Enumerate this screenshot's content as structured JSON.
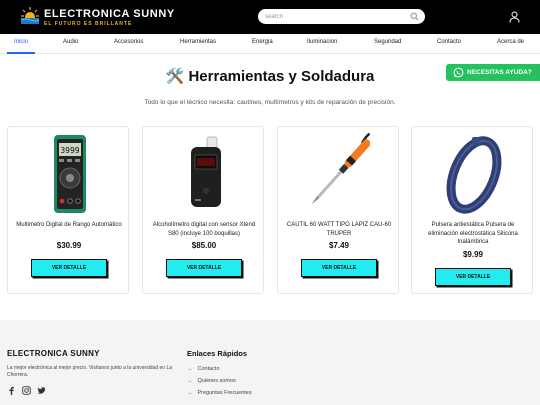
{
  "header": {
    "brand_name": "ELECTRONICA SUNNY",
    "brand_tagline": "EL FUTURO ES BRILLANTE",
    "search_placeholder": "search",
    "colors": {
      "bar": "#000000",
      "tagline": "#f0b429"
    }
  },
  "nav": {
    "items": [
      {
        "label": "Inicio",
        "active": true
      },
      {
        "label": "Audio"
      },
      {
        "label": "Accesorios"
      },
      {
        "label": "Herramientas"
      },
      {
        "label": "Energia"
      },
      {
        "label": "Iluminacion"
      },
      {
        "label": "Seguridad"
      },
      {
        "label": "Contacto"
      },
      {
        "label": "Acerca de"
      }
    ],
    "active_color": "#1a66ff"
  },
  "whatsapp": {
    "label": "NECESITAS AYUDA?",
    "color": "#25c05f"
  },
  "main": {
    "icon": "🛠️",
    "title": "Herramientas y Soldadura",
    "subtitle": "Todo lo que el técnico necesita: cautines, multímetros y kits de reparación de precisión."
  },
  "products": [
    {
      "name": "Multimetro Digital de Rango Automático",
      "price": "$30.99",
      "button": "VER DETALLE",
      "image_icon": "multimeter-image",
      "display": "3999"
    },
    {
      "name": "Alcoholímetro digital con sensor Xtend S80 (incluye 100 boquillas)",
      "price": "$85.00",
      "button": "VER DETALLE",
      "image_icon": "breathalyzer-image"
    },
    {
      "name": "CAUTIL 60 WATT TIPO LAPIZ CAU-60 TRUPER",
      "price": "$7.49",
      "button": "VER DETALLE",
      "image_icon": "soldering-iron-image"
    },
    {
      "name": "Pulsera antiestática Pulsera de eliminación electrostática Silicona Inalámbrica",
      "price": "$9.99",
      "button": "VER DETALLE",
      "image_icon": "antistatic-wristband-image"
    }
  ],
  "button_color": "#22ecf0",
  "footer": {
    "brand": "ELECTRONICA SUNNY",
    "description": "La mejor electrónica al mejor precio. Visítanos junto a la universidad en La Chorrera.",
    "social": [
      "facebook-icon",
      "instagram-icon",
      "twitter-icon"
    ],
    "links_title": "Enlaces Rápidos",
    "links": [
      "Contacto",
      "Quiénes somos",
      "Preguntas Frecuentes"
    ]
  }
}
